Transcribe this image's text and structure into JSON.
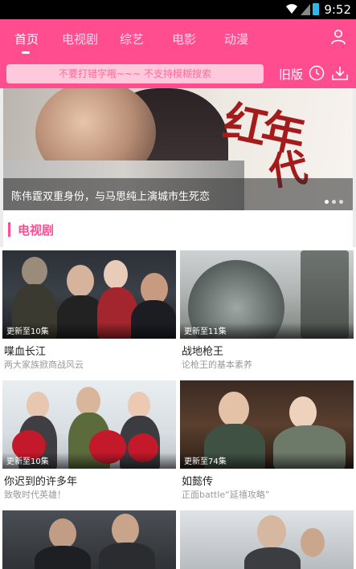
{
  "status_bar": {
    "time": "9:52"
  },
  "tabs": [
    "首页",
    "电视剧",
    "综艺",
    "电影",
    "动漫"
  ],
  "search": {
    "placeholder": "不要打错字哦~~~ 不支持模糊搜索"
  },
  "old_version_label": "旧版",
  "icons": {
    "user": "user-icon",
    "history": "clock-icon",
    "download": "download-icon"
  },
  "banner": {
    "caption": "陈伟霆双重身份，与马思纯上演城市生死恋",
    "calligraphy": "红年代"
  },
  "section": {
    "title": "电视剧"
  },
  "cards": [
    {
      "badge": "更新至10集",
      "name": "喋血长江",
      "desc": "两大家族掀商战风云"
    },
    {
      "badge": "更新至11集",
      "name": "战地枪王",
      "desc": "论枪王的基本素养"
    },
    {
      "badge": "更新至10集",
      "name": "你迟到的许多年",
      "desc": "致敬时代英雄！"
    },
    {
      "badge": "更新至74集",
      "name": "如懿传",
      "desc": "正面battle“延禧攻略”"
    }
  ],
  "colors": {
    "accent": "#ff4d8f",
    "search_bg": "#ffc9dc"
  }
}
